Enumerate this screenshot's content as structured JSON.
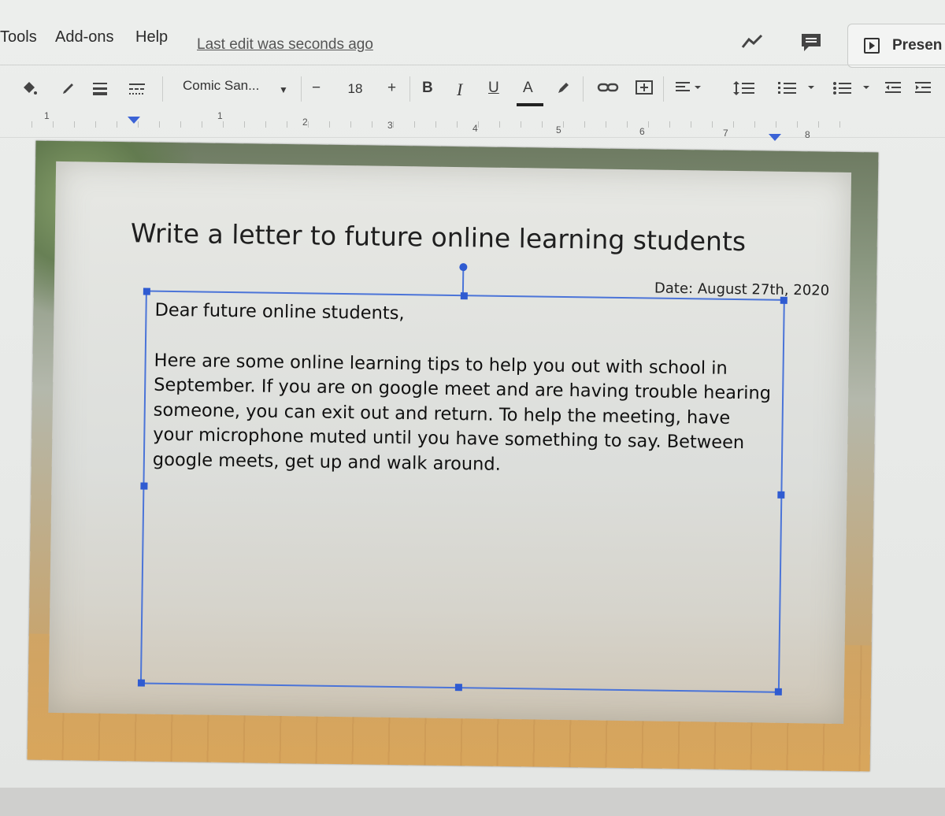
{
  "menu": {
    "items": [
      "Tools",
      "Add-ons",
      "Help"
    ],
    "last_edit": "Last edit was seconds ago",
    "present_label": "Presen"
  },
  "toolbar": {
    "font_name": "Comic San...",
    "font_size": "18",
    "decrease": "−",
    "increase": "+",
    "bold": "B",
    "italic": "I",
    "underline": "U",
    "text_color": "A"
  },
  "ruler": {
    "numbers": [
      "1",
      "1",
      "2",
      "3",
      "4",
      "5",
      "6",
      "7",
      "8"
    ]
  },
  "slide": {
    "title": "Write a letter to future online learning students",
    "date": "Date: August 27th, 2020",
    "greeting": "Dear future online students,",
    "body": "Here are some online learning tips to help you out with school in September. If you are on google meet and are having trouble hearing someone, you can exit out and return. To help the meeting, have your microphone muted until you have something to say. Between google meets, get up and walk around."
  },
  "colors": {
    "selection": "#2f5bd1",
    "text": "#111111"
  }
}
